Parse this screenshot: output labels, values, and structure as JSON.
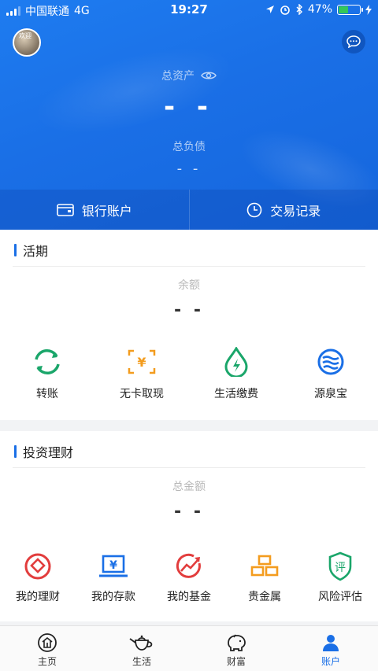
{
  "status_bar": {
    "carrier": "中国联通",
    "network": "4G",
    "time": "19:27",
    "battery_percent": "47%",
    "battery_level": 0.47
  },
  "header": {
    "avatar_text": "欢迎",
    "total_assets_label": "总资产",
    "total_assets_value": "- -",
    "total_liabilities_label": "总负债",
    "total_liabilities_value": "- -",
    "actions": [
      {
        "label": "银行账户",
        "icon": "card-icon"
      },
      {
        "label": "交易记录",
        "icon": "clock-icon"
      }
    ]
  },
  "current": {
    "title": "活期",
    "balance_label": "余额",
    "balance_value": "- -",
    "items": [
      {
        "label": "转账",
        "icon": "transfer-icon",
        "color": "#1aa66a"
      },
      {
        "label": "无卡取现",
        "icon": "cardless-cash-icon",
        "color": "#f39c1e"
      },
      {
        "label": "生活缴费",
        "icon": "bill-pay-icon",
        "color": "#1aa66a"
      },
      {
        "label": "源泉宝",
        "icon": "fountain-icon",
        "color": "#1a6fe6"
      }
    ]
  },
  "investment": {
    "title": "投资理财",
    "total_label": "总金额",
    "total_value": "- -",
    "items": [
      {
        "label": "我的理财",
        "icon": "wealth-icon",
        "color": "#e23d3d"
      },
      {
        "label": "我的存款",
        "icon": "deposit-icon",
        "color": "#1a6fe6"
      },
      {
        "label": "我的基金",
        "icon": "fund-icon",
        "color": "#e23d3d"
      },
      {
        "label": "贵金属",
        "icon": "gold-bars-icon",
        "color": "#f39c1e"
      },
      {
        "label": "风险评估",
        "icon": "risk-shield-icon",
        "color": "#1aa66a",
        "badge": "评"
      }
    ]
  },
  "tabbar": {
    "tabs": [
      {
        "label": "主页",
        "icon": "home-icon"
      },
      {
        "label": "生活",
        "icon": "teapot-icon"
      },
      {
        "label": "财富",
        "icon": "piggy-bank-icon"
      },
      {
        "label": "账户",
        "icon": "user-icon",
        "active": true
      }
    ]
  }
}
